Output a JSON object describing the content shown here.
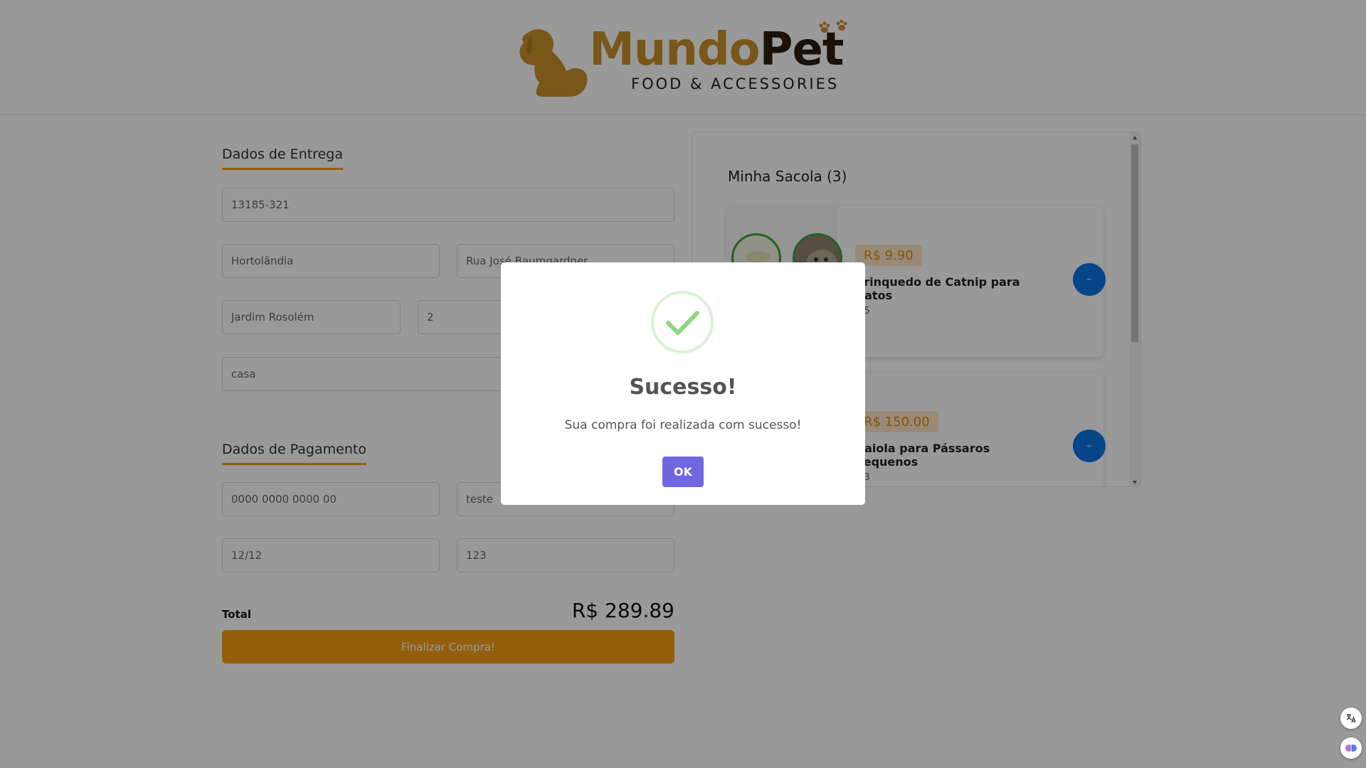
{
  "brand": {
    "name_part1": "Mundo",
    "name_part2": "Pet",
    "tagline": "FOOD & ACCESSORIES"
  },
  "delivery": {
    "title": "Dados de Entrega",
    "cep": "13185-321",
    "city": "Hortolândia",
    "street": "Rua José Baumgardner",
    "neighborhood": "Jardim Rosolém",
    "number": "2",
    "complement": "casa"
  },
  "payment": {
    "title": "Dados de Pagamento",
    "card_number": "0000 0000 0000 00",
    "card_name": "teste",
    "expiry": "12/12",
    "cvv": "123"
  },
  "summary": {
    "total_label": "Total",
    "total_value": "R$ 289.89",
    "finish_label": "Finalizar Compra!"
  },
  "bag": {
    "title": "Minha Sacola (3)",
    "items": [
      {
        "price": "R$ 9.90",
        "name": "Brinquedo de Catnip para Gatos",
        "rating": "4.5",
        "remove_label": "–"
      },
      {
        "price": "R$ 150.00",
        "name": "Gaiola para Pássaros Pequenos",
        "rating": "4.3",
        "remove_label": "–"
      }
    ]
  },
  "modal": {
    "title": "Sucesso!",
    "message": "Sua compra foi realizada com sucesso!",
    "ok_label": "OK"
  },
  "colors": {
    "accent_orange": "#f59e16",
    "brand_gold": "#c9922a",
    "brand_dark": "#2a1d12",
    "remove_blue": "#0d73e6",
    "ok_purple": "#7066e0",
    "success_green": "#8fd67f"
  },
  "icons": {
    "success": "check-icon",
    "remove": "minus-icon",
    "translate": "translate-icon",
    "assistant": "brain-icon"
  }
}
